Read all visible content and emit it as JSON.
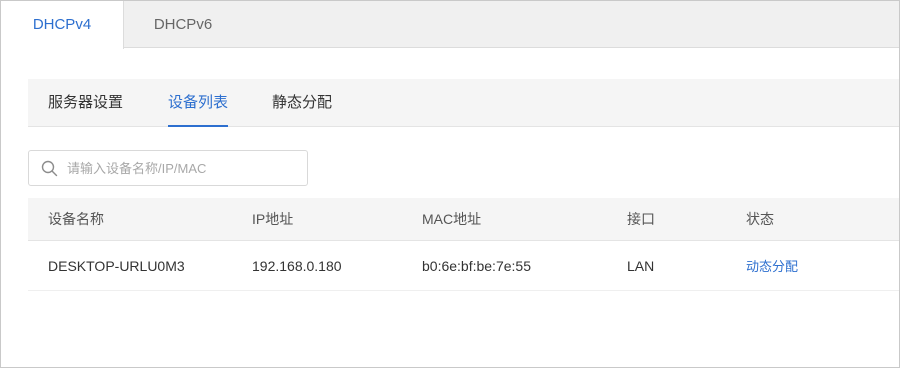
{
  "top_tabs": [
    {
      "label": "DHCPv4",
      "active": true
    },
    {
      "label": "DHCPv6",
      "active": false
    }
  ],
  "sub_tabs": [
    {
      "label": "服务器设置",
      "active": false
    },
    {
      "label": "设备列表",
      "active": true
    },
    {
      "label": "静态分配",
      "active": false
    }
  ],
  "search": {
    "placeholder": "请输入设备名称/IP/MAC",
    "value": "",
    "icon": "search-icon"
  },
  "table": {
    "headers": [
      "设备名称",
      "IP地址",
      "MAC地址",
      "接口",
      "状态"
    ],
    "rows": [
      {
        "name": "DESKTOP-URLU0M3",
        "ip": "192.168.0.180",
        "mac": "b0:6e:bf:be:7e:55",
        "interface": "LAN",
        "status": "动态分配"
      }
    ]
  },
  "colors": {
    "accent": "#2d6fcf",
    "tab_bg": "#f0f0f0",
    "header_bg": "#f5f5f5"
  }
}
